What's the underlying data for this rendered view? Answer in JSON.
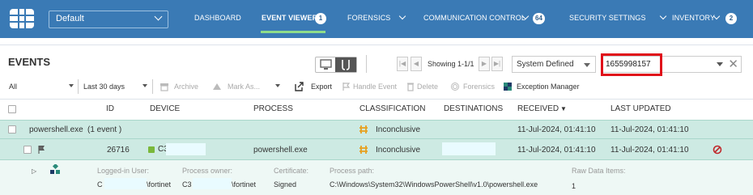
{
  "header": {
    "tenant": "Default",
    "nav": [
      {
        "label": "DASHBOARD"
      },
      {
        "label": "EVENT VIEWER",
        "badge": "1",
        "active": true
      },
      {
        "label": "FORENSICS"
      },
      {
        "label": "COMMUNICATION CONTROL",
        "badge": "64"
      },
      {
        "label": "SECURITY SETTINGS"
      },
      {
        "label": "INVENTORY",
        "badge": "2"
      }
    ]
  },
  "events": {
    "title": "EVENTS",
    "showing": "Showing 1-1/1",
    "filter_preset": "System Defined",
    "search_value": "1655998157"
  },
  "toolbar": {
    "scope": "All",
    "period": "Last 30 days",
    "archive": "Archive",
    "mark_as": "Mark As...",
    "export": "Export",
    "handle_event": "Handle Event",
    "delete": "Delete",
    "forensics": "Forensics",
    "exception_manager": "Exception Manager"
  },
  "table": {
    "columns": {
      "id": "ID",
      "device": "DEVICE",
      "process": "PROCESS",
      "classification": "CLASSIFICATION",
      "destinations": "DESTINATIONS",
      "received": "RECEIVED",
      "last_updated": "LAST UPDATED"
    },
    "group": {
      "process_name": "powershell.exe",
      "count": "(1 event )",
      "classification": "Inconclusive",
      "received": "11-Jul-2024, 01:41:10",
      "last_updated": "11-Jul-2024, 01:41:10"
    },
    "event": {
      "id": "26716",
      "device": "C3",
      "process": "powershell.exe",
      "classification": "Inconclusive",
      "received": "11-Jul-2024, 01:41:10",
      "last_updated": "11-Jul-2024, 01:41:10"
    },
    "detail": {
      "logged_in_label": "Logged-in User:",
      "logged_in_value_a": "C",
      "logged_in_value_b": "\\fortinet",
      "owner_label": "Process owner:",
      "owner_value_a": "C3",
      "owner_value_b": "\\fortinet",
      "cert_label": "Certificate:",
      "cert_value": "Signed",
      "path_label": "Process path:",
      "path_value": "C:\\Windows\\System32\\WindowsPowerShell\\v1.0\\powershell.exe",
      "raw_label": "Raw Data Items:",
      "raw_value": "1"
    }
  }
}
